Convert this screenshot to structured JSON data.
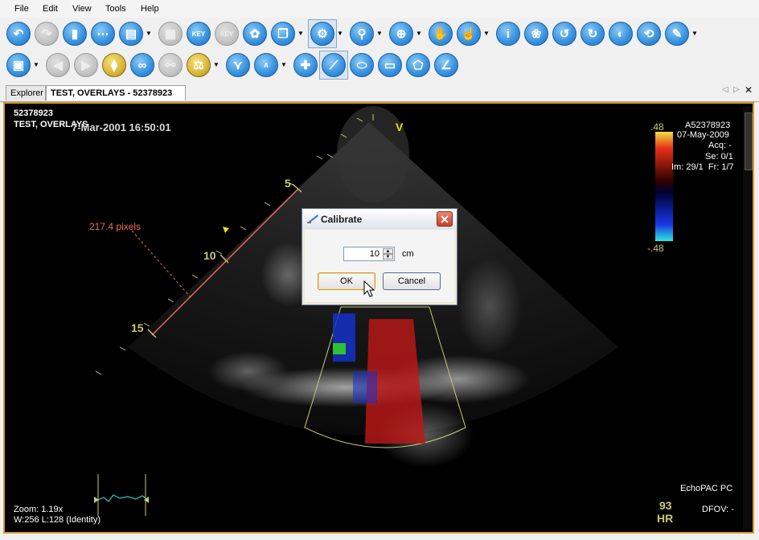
{
  "menu": [
    "File",
    "Edit",
    "View",
    "Tools",
    "Help"
  ],
  "toolbar1": [
    {
      "icon": "back-arrow-icon"
    },
    {
      "icon": "forward-arrow-icon",
      "disabled": true
    },
    {
      "icon": "clipboard-icon"
    },
    {
      "icon": "series-strip-icon"
    },
    {
      "icon": "layout-icon",
      "drop": true
    },
    {
      "icon": "grid-layout-icon",
      "disabled": true
    },
    {
      "icon": "key-icon",
      "label": "KEY"
    },
    {
      "icon": "key-image-icon",
      "disabled": true,
      "label": "KEY"
    },
    {
      "icon": "cine-reel-icon"
    },
    {
      "icon": "copy-window-icon",
      "drop": true
    },
    {
      "icon": "settings-gear-icon",
      "drop": true,
      "pressed": true
    },
    {
      "icon": "magnifier-icon",
      "drop": true
    },
    {
      "icon": "zoom-region-icon",
      "drop": true
    },
    {
      "icon": "pan-hand-icon"
    },
    {
      "icon": "pointer-pick-icon",
      "drop": true
    },
    {
      "icon": "info-icon"
    },
    {
      "icon": "footprints-icon"
    },
    {
      "icon": "rotate-left-icon"
    },
    {
      "icon": "rotate-right-icon"
    },
    {
      "icon": "contrast-icon"
    },
    {
      "icon": "undo-icon"
    },
    {
      "icon": "annotation-edit-icon",
      "drop": true
    }
  ],
  "toolbar2": [
    {
      "icon": "window-level-icon",
      "drop": true
    },
    {
      "icon": "previous-icon",
      "disabled": true
    },
    {
      "icon": "play-icon",
      "disabled": true
    },
    {
      "icon": "frame-marker-icon",
      "yellow": true
    },
    {
      "icon": "link-icon"
    },
    {
      "icon": "unlink-icon",
      "disabled": true
    },
    {
      "icon": "measure-tool-icon",
      "drop": true,
      "yellow": true
    },
    {
      "icon": "angle-tool-icon"
    },
    {
      "icon": "text-annotation-icon",
      "label": "A",
      "drop": true
    },
    {
      "icon": "crosshair-icon"
    },
    {
      "icon": "calibrate-line-icon",
      "pressed": true
    },
    {
      "icon": "ellipse-tool-icon"
    },
    {
      "icon": "rectangle-tool-icon"
    },
    {
      "icon": "polygon-tool-icon"
    },
    {
      "icon": "angle-measure-icon"
    }
  ],
  "tabs": {
    "explorer": "Explorer",
    "active": "TEST, OVERLAYS - 52378923"
  },
  "overlay": {
    "patient_id": "52378923",
    "patient_name": "TEST, OVERLAYS",
    "acq_time": "7-Mar-2001 16:50:01",
    "accession": "A52378923",
    "date": "07-May-2009",
    "acq": "Acq: -",
    "se": "Se: 0/1",
    "im": "Im: 29/1  Fr: 1/7",
    "scale_top": ".48",
    "scale_bottom": "-.48",
    "v_marker": "V",
    "depth_5": "5",
    "depth_10": "10",
    "depth_15": "15",
    "calib_pixels": "217.4 pixels",
    "zoom": "Zoom: 1.19x",
    "window_level": "W:256 L:128 (Identity)",
    "heart_rate_value": "93",
    "heart_rate_unit": "HR",
    "software": "EchoPAC PC",
    "dfov": "DFOV: -"
  },
  "dialog": {
    "title": "Calibrate",
    "value": "10",
    "unit": "cm",
    "ok": "OK",
    "cancel": "Cancel"
  },
  "colors": {
    "frame_accent": "#d89a2a",
    "button_blue": "#3b95e0",
    "calib_text": "#e87050",
    "depth_text": "#c8c878"
  }
}
